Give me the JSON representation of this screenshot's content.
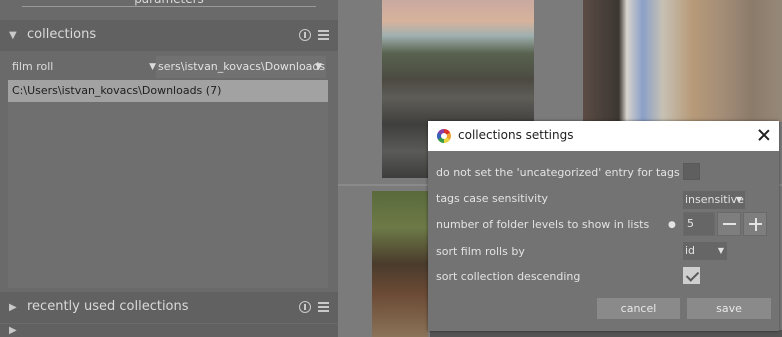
{
  "left_panel": {
    "top_module_label": "parameters",
    "collections_header": {
      "title": "collections",
      "arrow": "▼"
    },
    "filter": {
      "property": "film roll",
      "value": "sers\\istvan_kovacs\\Downloads",
      "dropdown_glyph": "▼"
    },
    "list": {
      "items": [
        {
          "label": "C:\\Users\\istvan_kovacs\\Downloads (7)"
        }
      ]
    },
    "recent_header": {
      "title": "recently used collections",
      "arrow": "▶"
    },
    "bottom_header": {
      "arrow": "▶"
    }
  },
  "dialog": {
    "title": "collections settings",
    "settings": [
      {
        "label": "do not set the 'uncategorized' entry for tags",
        "control": "checkbox",
        "checked": false
      },
      {
        "label": "tags case sensitivity",
        "control": "select",
        "value": "insensitive"
      },
      {
        "label": "number of folder levels to show in lists",
        "control": "spin",
        "value": "5",
        "bullet": "●"
      },
      {
        "label": "sort film rolls by",
        "control": "select",
        "value": "id"
      },
      {
        "label": "sort collection descending",
        "control": "checkbox",
        "checked": true
      }
    ],
    "buttons": {
      "cancel": "cancel",
      "save": "save"
    }
  },
  "colors": {
    "panel_bg": "#6a6a6a",
    "header_bg": "#616161",
    "selected_row": "#a2a2a2",
    "dialog_bg": "#737373",
    "titlebar_bg": "#ffffff"
  }
}
